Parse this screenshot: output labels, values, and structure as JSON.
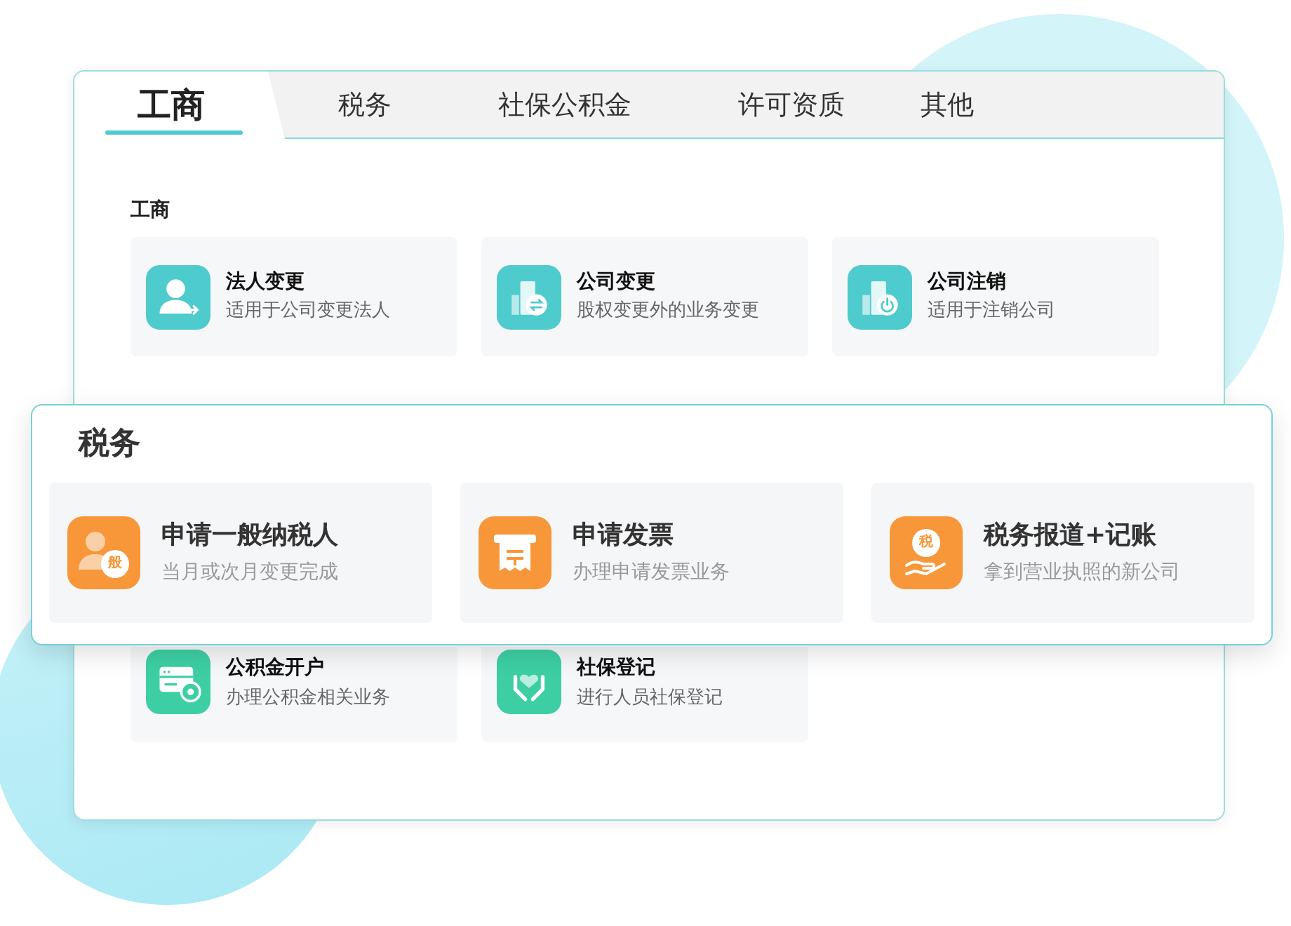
{
  "tabs": [
    {
      "label": "工商",
      "selected": true
    },
    {
      "label": "税务",
      "selected": false
    },
    {
      "label": "社保公积金",
      "selected": false
    },
    {
      "label": "许可资质",
      "selected": false
    },
    {
      "label": "其他",
      "selected": false
    }
  ],
  "main_panel": {
    "sections": [
      {
        "title": "工商",
        "color": "#4ecbcc",
        "items": [
          {
            "title": "法人变更",
            "subtitle": "适用于公司变更法人"
          },
          {
            "title": "公司变更",
            "subtitle": "股权变更外的业务变更"
          },
          {
            "title": "公司注销",
            "subtitle": "适用于注销公司"
          }
        ]
      },
      {
        "color": "#3dcfa3",
        "items": [
          {
            "title": "公积金开户",
            "subtitle": "办理公积金相关业务"
          },
          {
            "title": "社保登记",
            "subtitle": "进行人员社保登记"
          }
        ]
      }
    ]
  },
  "popout_card": {
    "title": "税务",
    "color": "#f7973a",
    "items": [
      {
        "title": "申请一般纳税人",
        "subtitle": "当月或次月变更完成",
        "icon_text": "般"
      },
      {
        "title": "申请发票",
        "subtitle": "办理申请发票业务"
      },
      {
        "title": "税务报道+记账",
        "subtitle": "拿到营业执照的新公司",
        "icon_text": "税"
      }
    ]
  }
}
